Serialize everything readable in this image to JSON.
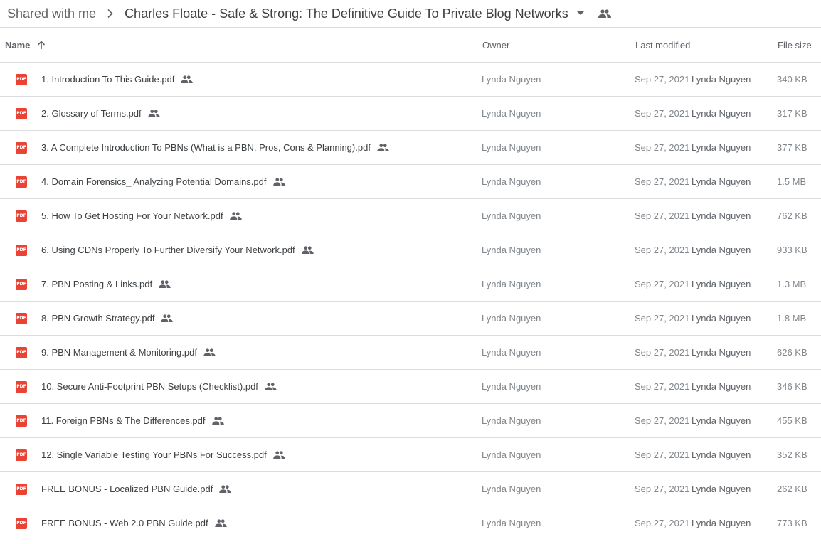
{
  "breadcrumb": {
    "root": "Shared with me",
    "separator_icon": "chevron-right-icon",
    "current": "Charles Floate - Safe & Strong: The Definitive Guide To Private Blog Networks",
    "dropdown_icon": "caret-down-icon",
    "shared_icon": "people-icon"
  },
  "columns": {
    "name": "Name",
    "sort_icon": "arrow-up-icon",
    "owner": "Owner",
    "last_modified": "Last modified",
    "file_size": "File size"
  },
  "file_icon_label": "PDF",
  "colors": {
    "pdf_red": "#ea4335",
    "divider": "#dadce0",
    "text_primary": "#3c4043",
    "text_secondary": "#80868b"
  },
  "files": [
    {
      "name": "1. Introduction To This Guide.pdf",
      "owner": "Lynda Nguyen",
      "modified_date": "Sep 27, 2021",
      "modified_by": "Lynda Nguyen",
      "size": "340 KB"
    },
    {
      "name": "2. Glossary of Terms.pdf",
      "owner": "Lynda Nguyen",
      "modified_date": "Sep 27, 2021",
      "modified_by": "Lynda Nguyen",
      "size": "317 KB"
    },
    {
      "name": "3. A Complete Introduction To PBNs (What is a PBN, Pros, Cons & Planning).pdf",
      "owner": "Lynda Nguyen",
      "modified_date": "Sep 27, 2021",
      "modified_by": "Lynda Nguyen",
      "size": "377 KB"
    },
    {
      "name": "4. Domain Forensics_ Analyzing Potential Domains.pdf",
      "owner": "Lynda Nguyen",
      "modified_date": "Sep 27, 2021",
      "modified_by": "Lynda Nguyen",
      "size": "1.5 MB"
    },
    {
      "name": "5. How To Get Hosting For Your Network.pdf",
      "owner": "Lynda Nguyen",
      "modified_date": "Sep 27, 2021",
      "modified_by": "Lynda Nguyen",
      "size": "762 KB"
    },
    {
      "name": "6. Using CDNs Properly To Further Diversify Your Network.pdf",
      "owner": "Lynda Nguyen",
      "modified_date": "Sep 27, 2021",
      "modified_by": "Lynda Nguyen",
      "size": "933 KB"
    },
    {
      "name": "7. PBN Posting & Links.pdf",
      "owner": "Lynda Nguyen",
      "modified_date": "Sep 27, 2021",
      "modified_by": "Lynda Nguyen",
      "size": "1.3 MB"
    },
    {
      "name": "8. PBN Growth Strategy.pdf",
      "owner": "Lynda Nguyen",
      "modified_date": "Sep 27, 2021",
      "modified_by": "Lynda Nguyen",
      "size": "1.8 MB"
    },
    {
      "name": "9. PBN Management & Monitoring.pdf",
      "owner": "Lynda Nguyen",
      "modified_date": "Sep 27, 2021",
      "modified_by": "Lynda Nguyen",
      "size": "626 KB"
    },
    {
      "name": "10. Secure Anti-Footprint PBN Setups (Checklist).pdf",
      "owner": "Lynda Nguyen",
      "modified_date": "Sep 27, 2021",
      "modified_by": "Lynda Nguyen",
      "size": "346 KB"
    },
    {
      "name": "11. Foreign PBNs & The Differences.pdf",
      "owner": "Lynda Nguyen",
      "modified_date": "Sep 27, 2021",
      "modified_by": "Lynda Nguyen",
      "size": "455 KB"
    },
    {
      "name": "12. Single Variable Testing Your PBNs For Success.pdf",
      "owner": "Lynda Nguyen",
      "modified_date": "Sep 27, 2021",
      "modified_by": "Lynda Nguyen",
      "size": "352 KB"
    },
    {
      "name": "FREE BONUS - Localized PBN Guide.pdf",
      "owner": "Lynda Nguyen",
      "modified_date": "Sep 27, 2021",
      "modified_by": "Lynda Nguyen",
      "size": "262 KB"
    },
    {
      "name": "FREE BONUS - Web 2.0 PBN Guide.pdf",
      "owner": "Lynda Nguyen",
      "modified_date": "Sep 27, 2021",
      "modified_by": "Lynda Nguyen",
      "size": "773 KB"
    }
  ]
}
